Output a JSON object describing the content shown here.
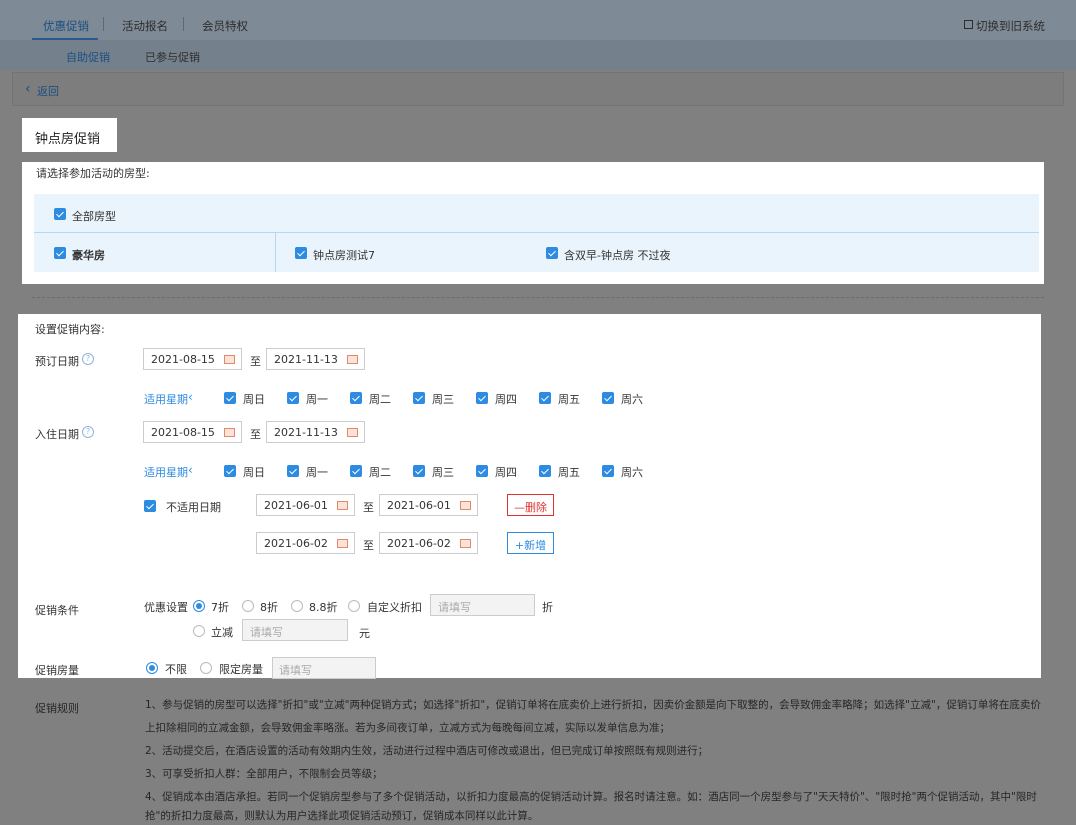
{
  "top_tabs": [
    {
      "label": "优惠促销",
      "active": true
    },
    {
      "label": "活动报名",
      "active": false
    },
    {
      "label": "会员特权",
      "active": false
    }
  ],
  "switch_system_label": "切换到旧系统",
  "sub_tabs": [
    {
      "label": "自助促销",
      "active": true
    },
    {
      "label": "已参与促销",
      "active": false
    }
  ],
  "back_label": "返回",
  "page_title": "钟点房促销",
  "room_section": {
    "heading": "请选择参加活动的房型:",
    "all_label": "全部房型",
    "group_label": "豪华房",
    "rooms": [
      "钟点房测试7",
      "含双早-钟点房 不过夜"
    ]
  },
  "promo_section": {
    "heading": "设置促销内容:",
    "booking_date_label": "预订日期",
    "booking_start": "2021-08-15",
    "booking_end": "2021-11-13",
    "checkin_date_label": "入住日期",
    "checkin_start": "2021-08-15",
    "checkin_end": "2021-11-13",
    "to_label": "至",
    "weekday_toggle": "适用星期",
    "weekdays": [
      "周日",
      "周一",
      "周二",
      "周三",
      "周四",
      "周五",
      "周六"
    ],
    "excluded_label": "不适用日期",
    "excluded_ranges": [
      {
        "start": "2021-06-01",
        "end": "2021-06-01"
      },
      {
        "start": "2021-06-02",
        "end": "2021-06-02"
      }
    ],
    "delete_label": "—删除",
    "add_label": "+新增"
  },
  "condition": {
    "label": "促销条件",
    "discount_label": "优惠设置",
    "options": [
      "7折",
      "8折",
      "8.8折",
      "自定义折扣"
    ],
    "custom_placeholder": "请填写",
    "discount_unit": "折",
    "reduce_label": "立减",
    "reduce_placeholder": "请填写",
    "reduce_unit": "元"
  },
  "quantity": {
    "label": "促销房量",
    "options": [
      "不限",
      "限定房量"
    ],
    "placeholder": "请填写"
  },
  "rules": {
    "label": "促销规则",
    "lines": [
      "1、参与促销的房型可以选择\"折扣\"或\"立减\"两种促销方式；如选择\"折扣\"，促销订单将在底卖价上进行折扣，因卖价金额是向下取整的，会导致佣金率略降；如选择\"立减\"，促销订单将在底卖价",
      "上扣除相同的立减金额，会导致佣金率略涨。若为多间夜订单，立减方式为每晚每间立减，实际以发单信息为准；",
      "2、活动提交后，在酒店设置的活动有效期内生效，活动进行过程中酒店可修改或退出，但已完成订单按照既有规则进行；",
      "3、可享受折扣人群：全部用户，不限制会员等级；",
      "4、促销成本由酒店承担。若同一个促销房型参与了多个促销活动，以折扣力度最高的促销活动计算。报名时请注意。如：酒店同一个房型参与了\"天天特价\"、\"限时抢\"两个促销活动，其中\"限时",
      "抢\"的折扣力度最高，则默认为用户选择此项促销活动预订，促销成本同样以此计算。"
    ]
  },
  "colors": {
    "accent": "#2d8be2",
    "danger": "#e0322f",
    "overlay": "#808080"
  }
}
